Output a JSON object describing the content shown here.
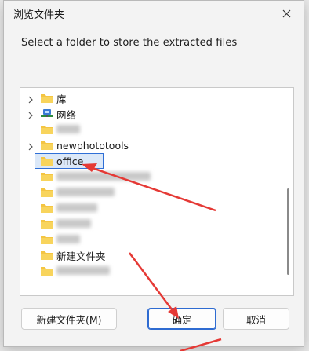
{
  "window": {
    "title": "浏览文件夹"
  },
  "prompt": "Select a folder to store the extracted files",
  "tree": {
    "items": [
      {
        "label": "库",
        "icon": "folder-icon",
        "expandable": true
      },
      {
        "label": "网络",
        "icon": "network-icon",
        "expandable": true
      },
      {
        "label": "",
        "icon": "folder-icon",
        "blurred": true
      },
      {
        "label": "newphototools",
        "icon": "folder-icon",
        "expandable": true
      },
      {
        "label": "office",
        "icon": "folder-icon",
        "selected": true
      },
      {
        "label": "",
        "icon": "folder-icon",
        "blurred": true
      },
      {
        "label": "",
        "icon": "folder-icon",
        "blurred": true
      },
      {
        "label": "",
        "icon": "folder-icon",
        "blurred": true
      },
      {
        "label": "",
        "icon": "folder-icon",
        "blurred": true
      },
      {
        "label": "",
        "icon": "folder-icon",
        "blurred": true
      },
      {
        "label": "新建文件夹",
        "icon": "folder-icon"
      },
      {
        "label": "",
        "icon": "folder-icon",
        "blurred": true
      }
    ]
  },
  "buttons": {
    "new_folder": "新建文件夹(M)",
    "ok": "确定",
    "cancel": "取消"
  },
  "colors": {
    "selection_border": "#2f6fd6",
    "annotation_arrow": "#e53935",
    "folder": "#f4c542"
  }
}
